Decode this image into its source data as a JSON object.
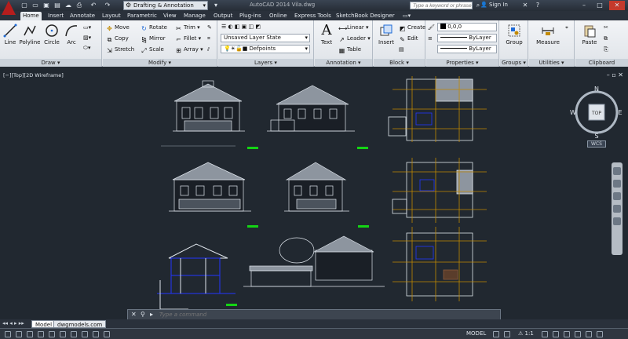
{
  "app": {
    "window_title": "AutoCAD 2014  Vila.dwg",
    "workspace": "Drafting & Annotation",
    "search_placeholder": "Type a keyword or phrase",
    "sign_in": "Sign In"
  },
  "tabs": [
    "Home",
    "Insert",
    "Annotate",
    "Layout",
    "Parametric",
    "View",
    "Manage",
    "Output",
    "Plug-ins",
    "Online",
    "Express Tools",
    "SketchBook Designer"
  ],
  "active_tab": "Home",
  "ribbon": {
    "draw": {
      "title": "Draw",
      "line": "Line",
      "polyline": "Polyline",
      "circle": "Circle",
      "arc": "Arc"
    },
    "modify": {
      "title": "Modify",
      "items": [
        "Move",
        "Rotate",
        "Trim",
        "Copy",
        "Mirror",
        "Fillet",
        "Stretch",
        "Scale",
        "Array"
      ]
    },
    "layers": {
      "title": "Layers",
      "layer_state": "Unsaved Layer State",
      "current_layer": "Defpoints"
    },
    "annotation": {
      "title": "Annotation",
      "text": "Text",
      "linear": "Linear",
      "leader": "Leader",
      "table": "Table"
    },
    "block": {
      "title": "Block",
      "insert": "Insert",
      "create": "Create",
      "edit": "Edit"
    },
    "properties": {
      "title": "Properties",
      "color": "0,0,0",
      "linetype": "ByLayer",
      "lineweight": "ByLayer"
    },
    "groups": {
      "title": "Groups",
      "group": "Group"
    },
    "utilities": {
      "title": "Utilities",
      "measure": "Measure"
    },
    "clipboard": {
      "title": "Clipboard",
      "paste": "Paste"
    }
  },
  "viewport": {
    "label": "[−][Top][2D Wireframe]"
  },
  "compass": {
    "n": "N",
    "s": "S",
    "e": "E",
    "w": "W",
    "top": "TOP",
    "wcs": "WCS"
  },
  "command": {
    "placeholder": "Type a command"
  },
  "model_tabs": [
    "Model",
    "dwgmodels.com"
  ],
  "status": {
    "model": "MODEL",
    "scale": "1:1"
  },
  "colors": {
    "accent": "#1e6ad6",
    "background": "#212830",
    "green": "#14d414",
    "blue": "#2236ff"
  }
}
